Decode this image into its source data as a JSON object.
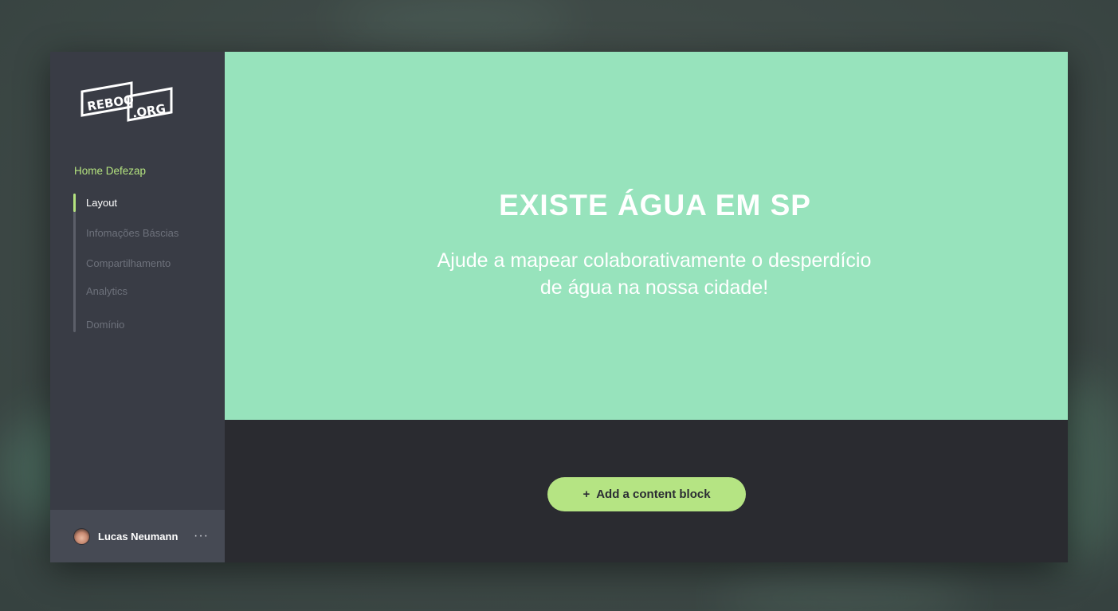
{
  "brand": {
    "logo_text_left": "REBOO",
    "logo_text_right": ".ORG"
  },
  "sidebar": {
    "project_title": "Home Defezap",
    "nav_items": [
      {
        "label": "Layout",
        "active": true
      },
      {
        "label": "Infomações Báscias",
        "active": false
      },
      {
        "label": "Compartilhamento",
        "active": false
      },
      {
        "label": "Analytics",
        "active": false
      },
      {
        "label": "Domínio",
        "active": false
      }
    ]
  },
  "user": {
    "name": "Lucas Neumann",
    "more_label": "···"
  },
  "hero": {
    "title": "EXISTE ÁGUA EM SP",
    "subtitle_line1": "Ajude a mapear colaborativamente o desperdício",
    "subtitle_line2": "de água na nossa cidade!"
  },
  "actions": {
    "add_block_label": "Add a content block"
  },
  "colors": {
    "accent": "#b4e37f",
    "hero_bg": "#97e3bc",
    "sidebar_bg": "#393c45",
    "main_bg": "#2a2b30"
  },
  "icons": {
    "add": "plus-icon",
    "more": "more-horizontal-icon"
  }
}
